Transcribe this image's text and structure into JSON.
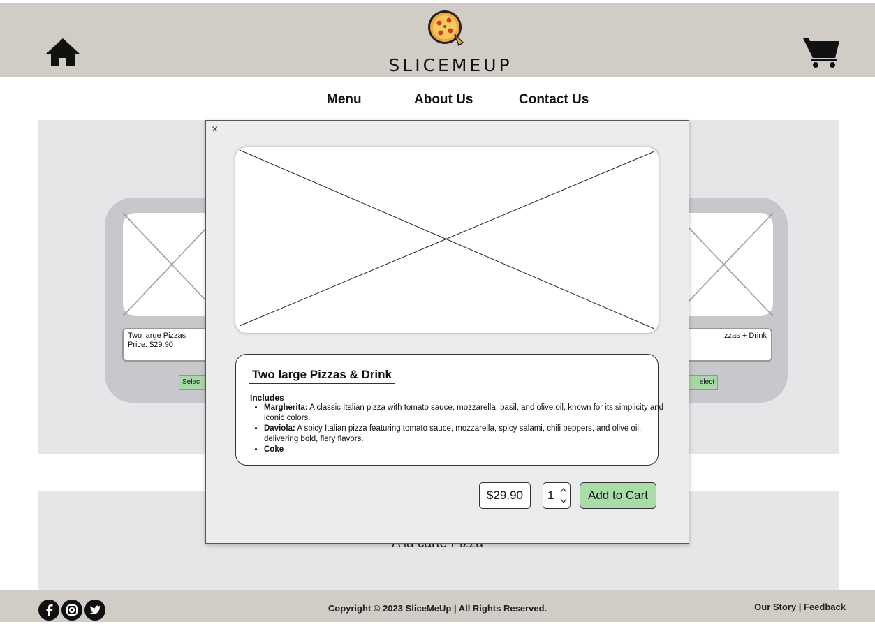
{
  "header": {
    "brand": "SLICEMEUP",
    "home_icon": "home-icon",
    "cart_icon": "cart-icon",
    "logo_icon": "pizza-logo-icon",
    "background": "#d1ccc6"
  },
  "nav": {
    "items": [
      {
        "label": "Menu"
      },
      {
        "label": "About Us"
      },
      {
        "label": "Contact Us"
      }
    ]
  },
  "background_cards": {
    "left": {
      "line1": "Two large Pizzas",
      "line2": "Price: $29.90",
      "select": "Selec"
    },
    "right": {
      "line1": "zzas + Drink",
      "line2": ")",
      "select": "elect"
    }
  },
  "section2": {
    "title": "A la carte Pizza"
  },
  "modal": {
    "close_label": "×",
    "item_title": "Two large Pizzas & Drink",
    "includes_label": "Includes",
    "items": [
      {
        "name": "Margherita:",
        "desc": "A classic Italian pizza with tomato sauce, mozzarella, basil, and olive oil, known for its simplicity and iconic colors."
      },
      {
        "name": "Daviola:",
        "desc": "A spicy Italian pizza featuring tomato sauce, mozzarella, spicy salami, chili peppers, and olive oil, delivering bold, fiery flavors."
      },
      {
        "name": "Coke",
        "desc": ""
      }
    ],
    "price": "$29.90",
    "quantity": "1",
    "add_to_cart": "Add to Cart",
    "accent": "#a8dca8"
  },
  "footer": {
    "social_icons": [
      "facebook-icon",
      "instagram-icon",
      "twitter-icon"
    ],
    "copyright": "Copyright © 2023 SliceMeUp | All Rights Reserved.",
    "links": [
      "Our Story",
      "Feedback"
    ],
    "separator": "|"
  }
}
